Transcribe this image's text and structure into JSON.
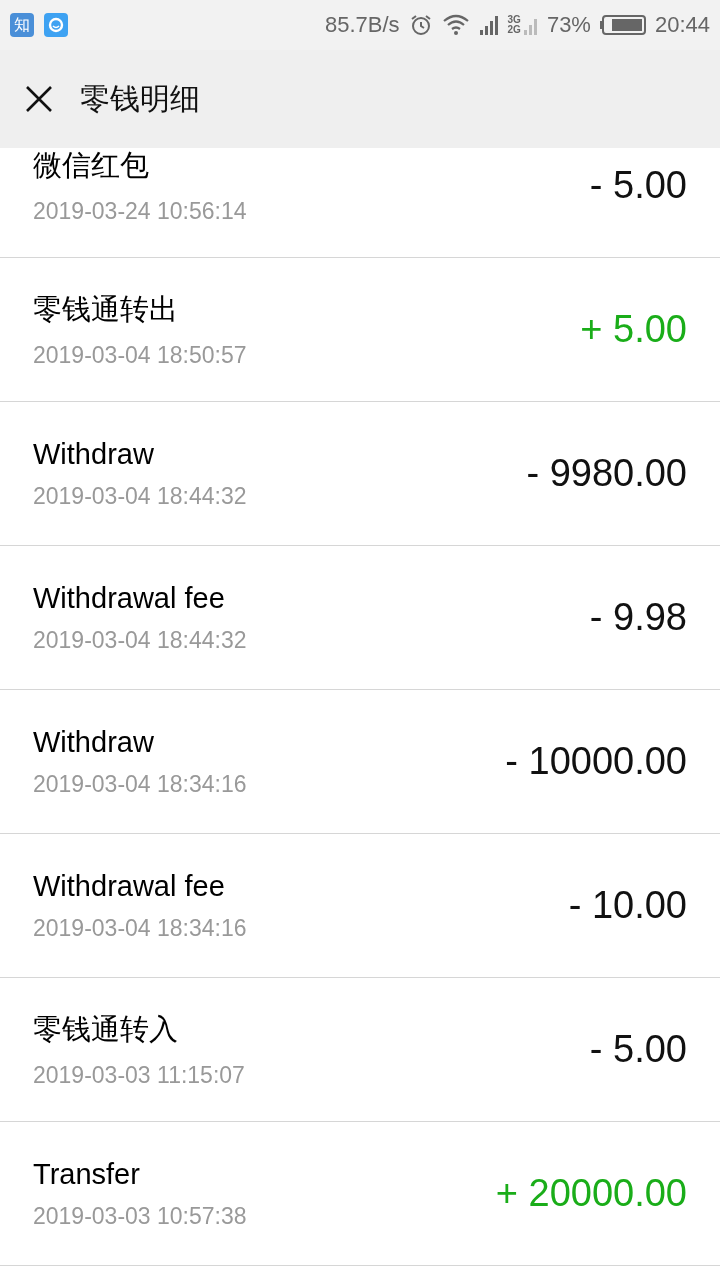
{
  "status_bar": {
    "app_icons": [
      {
        "kind": "text",
        "label": "知"
      },
      {
        "kind": "circle"
      }
    ],
    "net_speed": "85.7B/s",
    "network_labels": [
      "3G",
      "2G"
    ],
    "battery": "73%",
    "time": "20:44"
  },
  "header": {
    "title": "零钱明细"
  },
  "transactions": [
    {
      "title": "微信红包",
      "time": "2019-03-24 10:56:14",
      "amount": "- 5.00",
      "kind": "expense"
    },
    {
      "title": "零钱通转出",
      "time": "2019-03-04 18:50:57",
      "amount": "+ 5.00",
      "kind": "income"
    },
    {
      "title": "Withdraw",
      "time": "2019-03-04 18:44:32",
      "amount": "- 9980.00",
      "kind": "expense"
    },
    {
      "title": "Withdrawal fee",
      "time": "2019-03-04 18:44:32",
      "amount": "- 9.98",
      "kind": "expense"
    },
    {
      "title": "Withdraw",
      "time": "2019-03-04 18:34:16",
      "amount": "- 10000.00",
      "kind": "expense"
    },
    {
      "title": "Withdrawal fee",
      "time": "2019-03-04 18:34:16",
      "amount": "- 10.00",
      "kind": "expense"
    },
    {
      "title": "零钱通转入",
      "time": "2019-03-03 11:15:07",
      "amount": "- 5.00",
      "kind": "expense"
    },
    {
      "title": "Transfer",
      "time": "2019-03-03 10:57:38",
      "amount": "+ 20000.00",
      "kind": "income"
    }
  ]
}
